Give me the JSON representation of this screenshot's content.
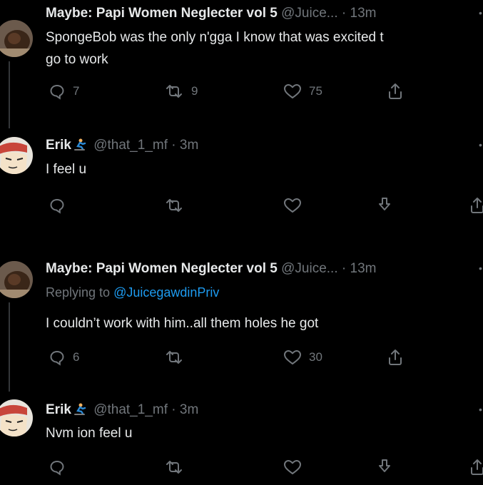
{
  "tweets": [
    {
      "author": "Maybe: Papi Women Neglecter vol 5",
      "handle": "@Juice...",
      "separator": "·",
      "time": "13m",
      "text_lines": [
        "SpongeBob was the only n'gga I know that was excited t",
        "go to work"
      ],
      "counts": {
        "reply": "7",
        "retweet": "9",
        "like": "75"
      }
    },
    {
      "author": "Erik",
      "handle": "@that_1_mf",
      "separator": "·",
      "time": "3m",
      "text_lines": [
        "I feel u"
      ],
      "counts": {
        "reply": "",
        "retweet": "",
        "like": ""
      }
    },
    {
      "author": "Maybe: Papi Women Neglecter vol 5",
      "handle": "@Juice...",
      "separator": "·",
      "time": "13m",
      "replying_prefix": "Replying to",
      "replying_to": "@JuicegawdinPriv",
      "text_lines": [
        "I couldn’t work with him..all them holes he got"
      ],
      "counts": {
        "reply": "6",
        "retweet": "",
        "like": "30"
      }
    },
    {
      "author": "Erik",
      "handle": "@that_1_mf",
      "separator": "·",
      "time": "3m",
      "text_lines": [
        "Nvm ion feel u"
      ],
      "counts": {
        "reply": "",
        "retweet": "",
        "like": ""
      }
    }
  ],
  "icons": {
    "reply": "speech-bubble-icon",
    "retweet": "retweet-arrows-icon",
    "like": "heart-icon",
    "share": "share-upload-icon",
    "verified": "skateboarder-emoji-icon"
  },
  "colors": {
    "background": "#000000",
    "text": "#e7e9ea",
    "muted": "#71767b",
    "link": "#1d9bf0"
  }
}
